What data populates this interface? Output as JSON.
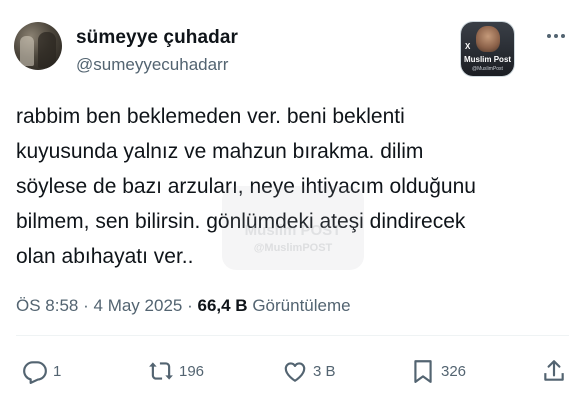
{
  "author": {
    "display_name": "sümeyye çuhadar",
    "handle": "@sumeyyecuhadarr"
  },
  "badge": {
    "title": "Muslim Post",
    "subtitle": "@MuslimPost",
    "x_mark": "X"
  },
  "watermark": {
    "title": "Muslim POST",
    "subtitle": "@MuslimPOST"
  },
  "tweet": {
    "text": "rabbim ben beklemeden ver. beni beklenti\nkuyusunda yalnız ve mahzun bırakma. dilim\nsöylese de bazı arzuları, neye ihtiyacım olduğunu\nbilmem, sen bilirsin. gönlümdeki ateşi dindirecek\nolan abıhayatı ver..",
    "time": "ÖS 8:58",
    "separator": "·",
    "date": "4 May 2025",
    "views_count": "66,4 B",
    "views_label": "Görüntüleme"
  },
  "actions": {
    "replies": "1",
    "reposts": "196",
    "likes": "3 B",
    "bookmarks": "326"
  },
  "icons": {
    "more": "more-horizontal-icon",
    "reply": "reply-icon",
    "repost": "repost-icon",
    "like": "heart-icon",
    "bookmark": "bookmark-icon",
    "share": "share-icon"
  },
  "colors": {
    "text": "#0f1419",
    "secondary": "#536471",
    "divider": "#eff3f4"
  }
}
